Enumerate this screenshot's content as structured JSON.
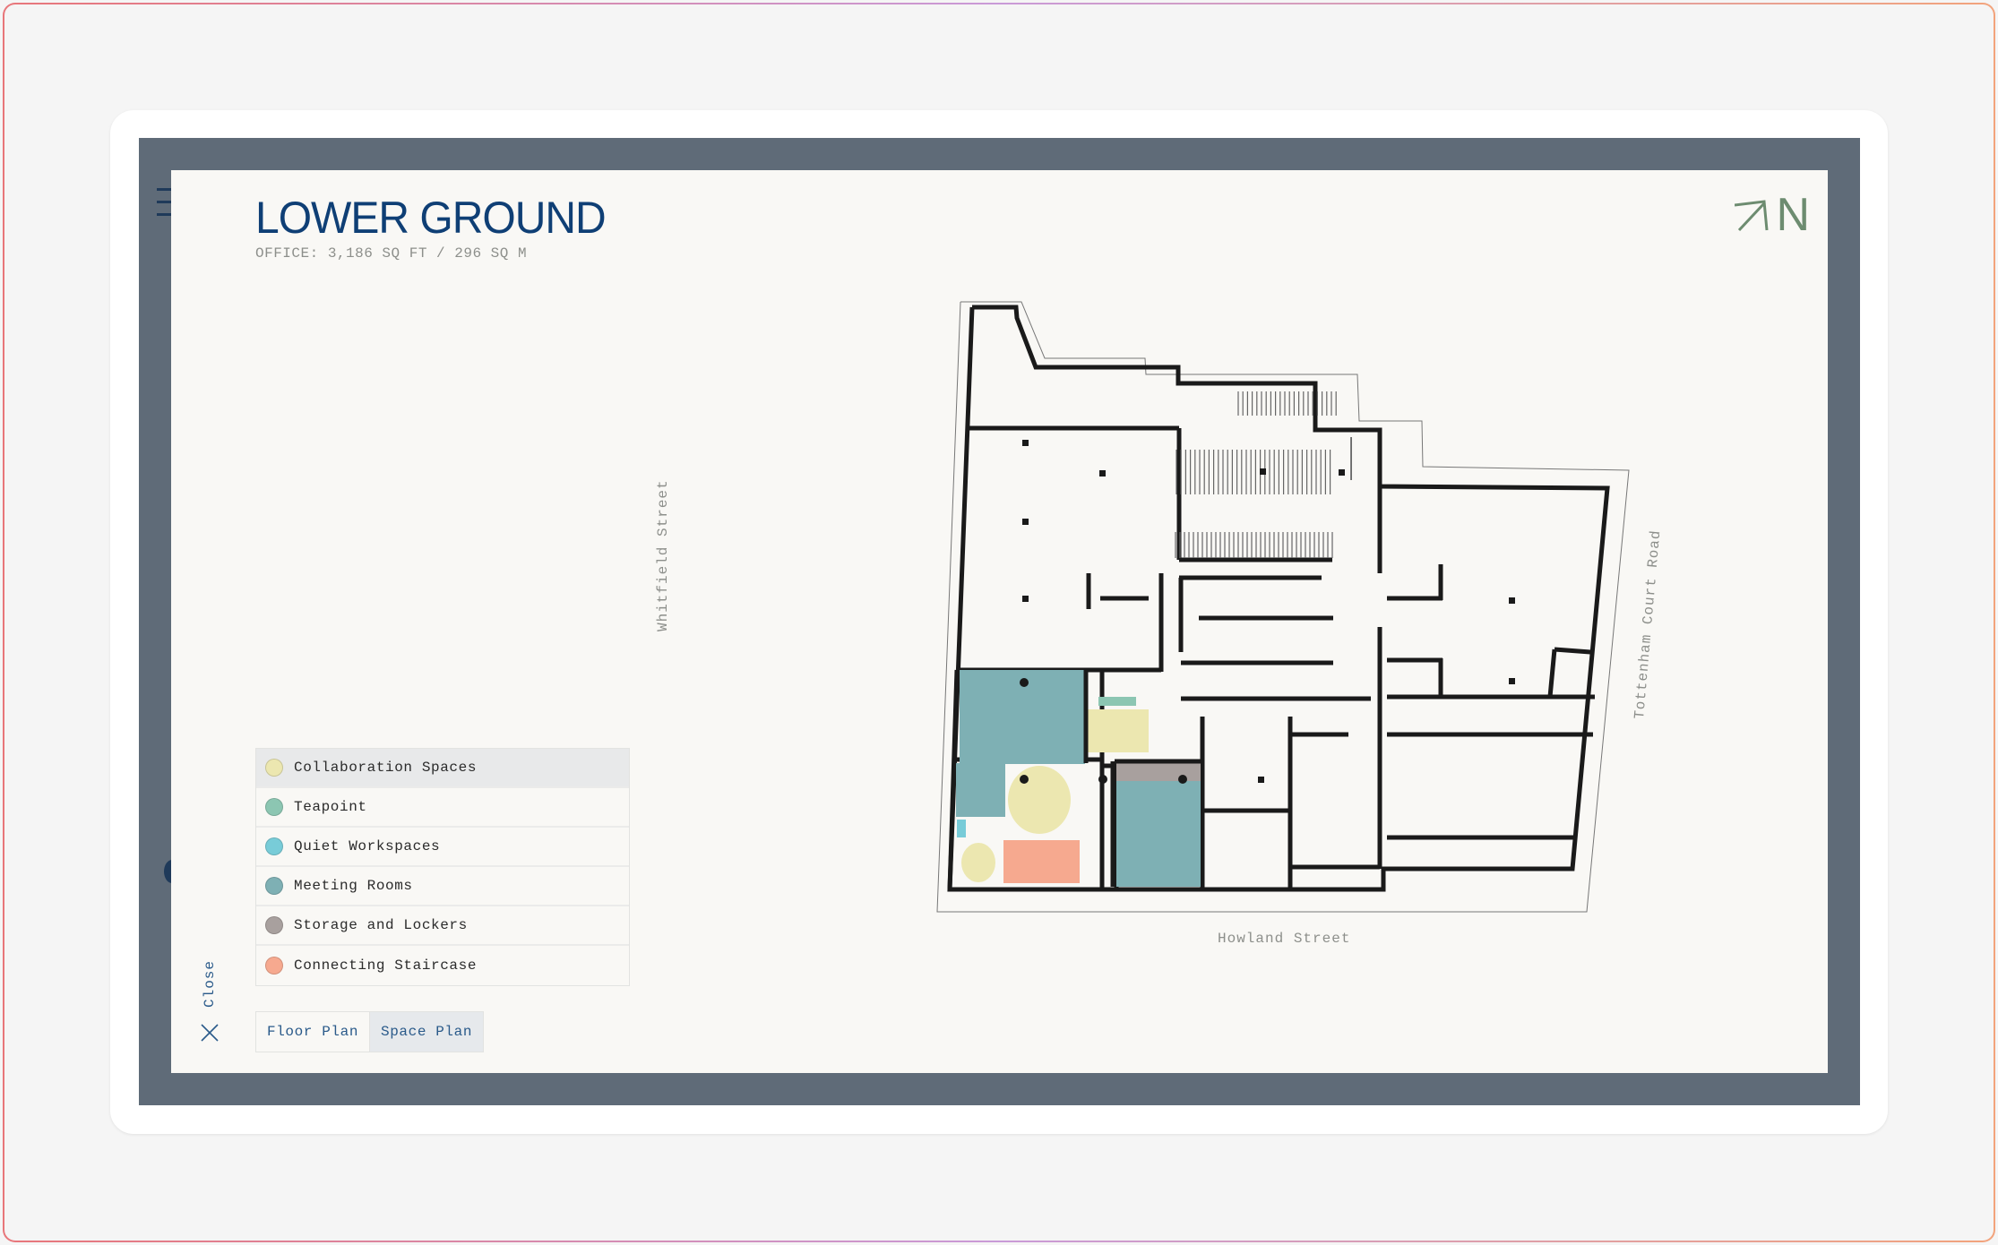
{
  "floor": {
    "title": "LOWER GROUND",
    "subtitle": "OFFICE: 3,186 SQ FT / 296 SQ M",
    "north_label": "N"
  },
  "legend": {
    "items": [
      {
        "label": "Collaboration Spaces",
        "color": "#ece7b0",
        "active": true
      },
      {
        "label": "Teapoint",
        "color": "#8cc6b2",
        "active": false
      },
      {
        "label": "Quiet Workspaces",
        "color": "#78ccd8",
        "active": false
      },
      {
        "label": "Meeting Rooms",
        "color": "#7eb0b4",
        "active": false
      },
      {
        "label": "Storage and Lockers",
        "color": "#a8a09e",
        "active": false
      },
      {
        "label": "Connecting Staircase",
        "color": "#f6a98f",
        "active": false
      }
    ]
  },
  "controls": {
    "close_label": "Close",
    "view_toggle": [
      {
        "label": "Floor Plan",
        "active": false
      },
      {
        "label": "Space Plan",
        "active": true
      }
    ]
  },
  "streets": {
    "west": "Whitfield Street",
    "east": "Tottenham Court Road",
    "south": "Howland Street"
  },
  "colors": {
    "frame": "#5f6b78",
    "title": "#0f3f75",
    "north": "#6d8c70",
    "panel": "#f9f8f5"
  }
}
